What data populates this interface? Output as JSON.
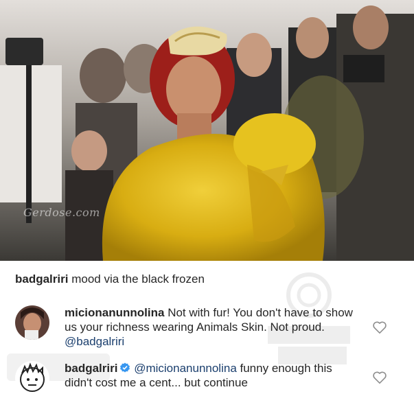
{
  "photo": {
    "watermark": "Gerdose.com"
  },
  "caption": {
    "username": "badgalriri",
    "text": "mood via the black frozen"
  },
  "comments": [
    {
      "username": "micionanunnolina",
      "text": "Not with fur! You don't have to show us your richness wearing Animals Skin. Not proud. ",
      "mention": "@badgalriri",
      "icons": [
        "avatar",
        "heart-icon"
      ]
    },
    {
      "username": "badgalriri",
      "verified": true,
      "mention": "@micionanunnolina",
      "text": " funny enough this didn't cost me a cent... but continue",
      "icons": [
        "cartoon-avatar",
        "verified-badge-icon",
        "heart-icon"
      ]
    }
  ],
  "colors": {
    "mention": "#1b3f6e",
    "verified": "#3897f0",
    "fur": "#e0b514"
  }
}
